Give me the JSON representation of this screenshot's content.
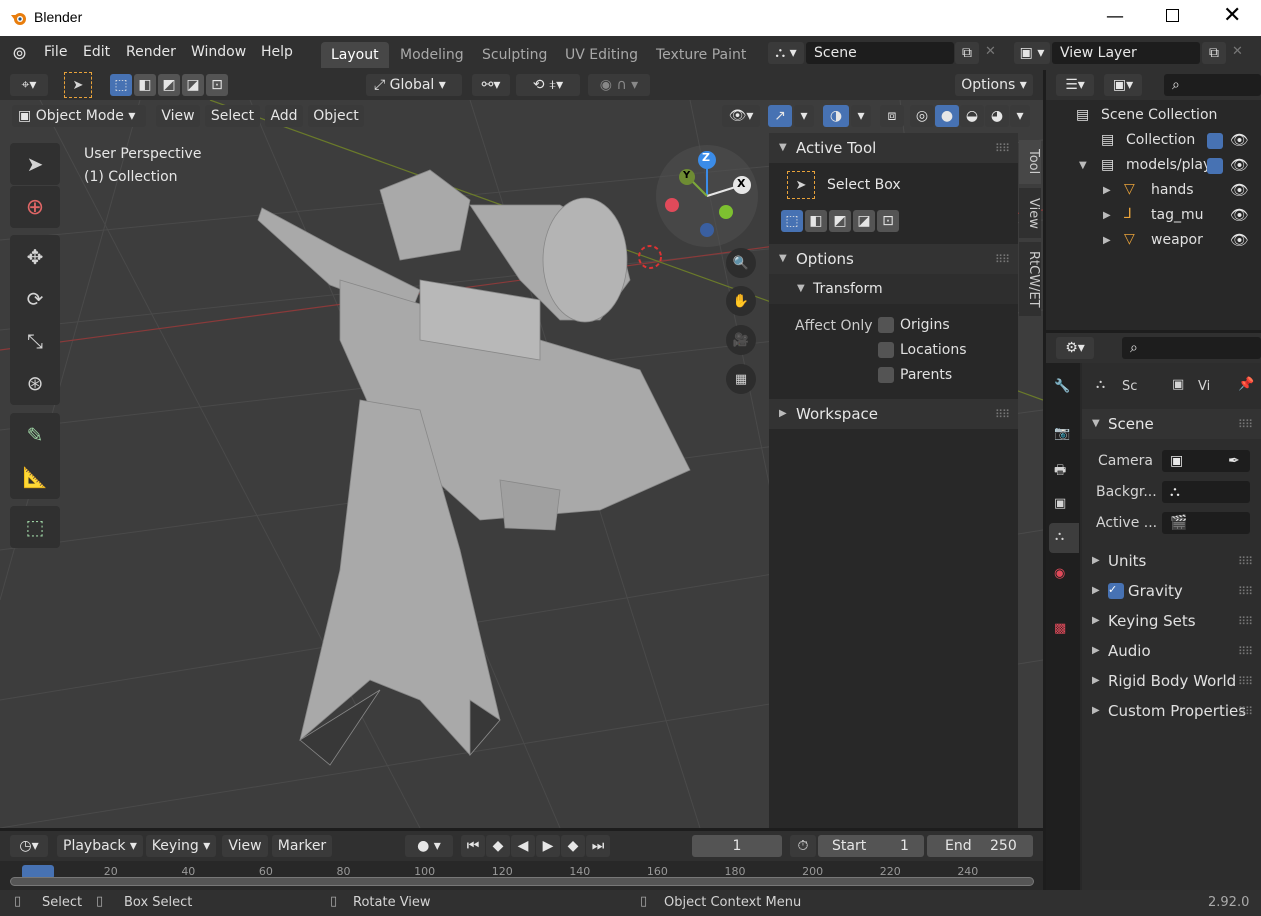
{
  "app": {
    "title": "Blender",
    "version": "2.92.0"
  },
  "menus": [
    "File",
    "Edit",
    "Render",
    "Window",
    "Help"
  ],
  "workspaces": [
    "Layout",
    "Modeling",
    "Sculpting",
    "UV Editing",
    "Texture Paint"
  ],
  "scene": {
    "name": "Scene",
    "view_layer": "View Layer"
  },
  "toolbar": {
    "orientation": "Global",
    "options": "Options"
  },
  "viewport_header": {
    "mode": "Object Mode",
    "menus": [
      "View",
      "Select",
      "Add",
      "Object"
    ]
  },
  "viewport": {
    "perspective": "User Perspective",
    "collection": "(1) Collection",
    "gizmo": {
      "z": "Z",
      "y": "Y",
      "x": "X"
    }
  },
  "n_panel": {
    "tabs": [
      "Tool",
      "View",
      "RtCW/ET"
    ],
    "active_tool_header": "Active Tool",
    "active_tool": "Select Box",
    "options_header": "Options",
    "transform_header": "Transform",
    "affect_only": "Affect Only",
    "checks": [
      "Origins",
      "Locations",
      "Parents"
    ],
    "workspace_header": "Workspace"
  },
  "outliner": {
    "rows": [
      {
        "label": "Scene Collection"
      },
      {
        "label": "Collection"
      },
      {
        "label": "models/play"
      },
      {
        "label": "hands"
      },
      {
        "label": "tag_mu"
      },
      {
        "label": "weapor"
      }
    ]
  },
  "properties": {
    "tab1": "Sc",
    "tab2": "Vi",
    "scene_header": "Scene",
    "camera_label": "Camera",
    "background_label": "Backgr...",
    "active_label": "Active ...",
    "sections": [
      "Units",
      "Gravity",
      "Keying Sets",
      "Audio",
      "Rigid Body World",
      "Custom Properties"
    ]
  },
  "timeline": {
    "menus": [
      "Playback",
      "Keying",
      "View",
      "Marker"
    ],
    "current_frame": "1",
    "start_label": "Start",
    "start": "1",
    "end_label": "End",
    "end": "250",
    "ticks": [
      "1",
      "20",
      "40",
      "60",
      "80",
      "100",
      "120",
      "140",
      "160",
      "180",
      "200",
      "220",
      "240"
    ]
  },
  "statusbar": {
    "select": "Select",
    "box_select": "Box Select",
    "rotate": "Rotate View",
    "context": "Object Context Menu"
  },
  "colors": {
    "accent": "#4772b3",
    "header": "#303030",
    "panel": "#282828",
    "viewport": "#3d3d3d"
  }
}
